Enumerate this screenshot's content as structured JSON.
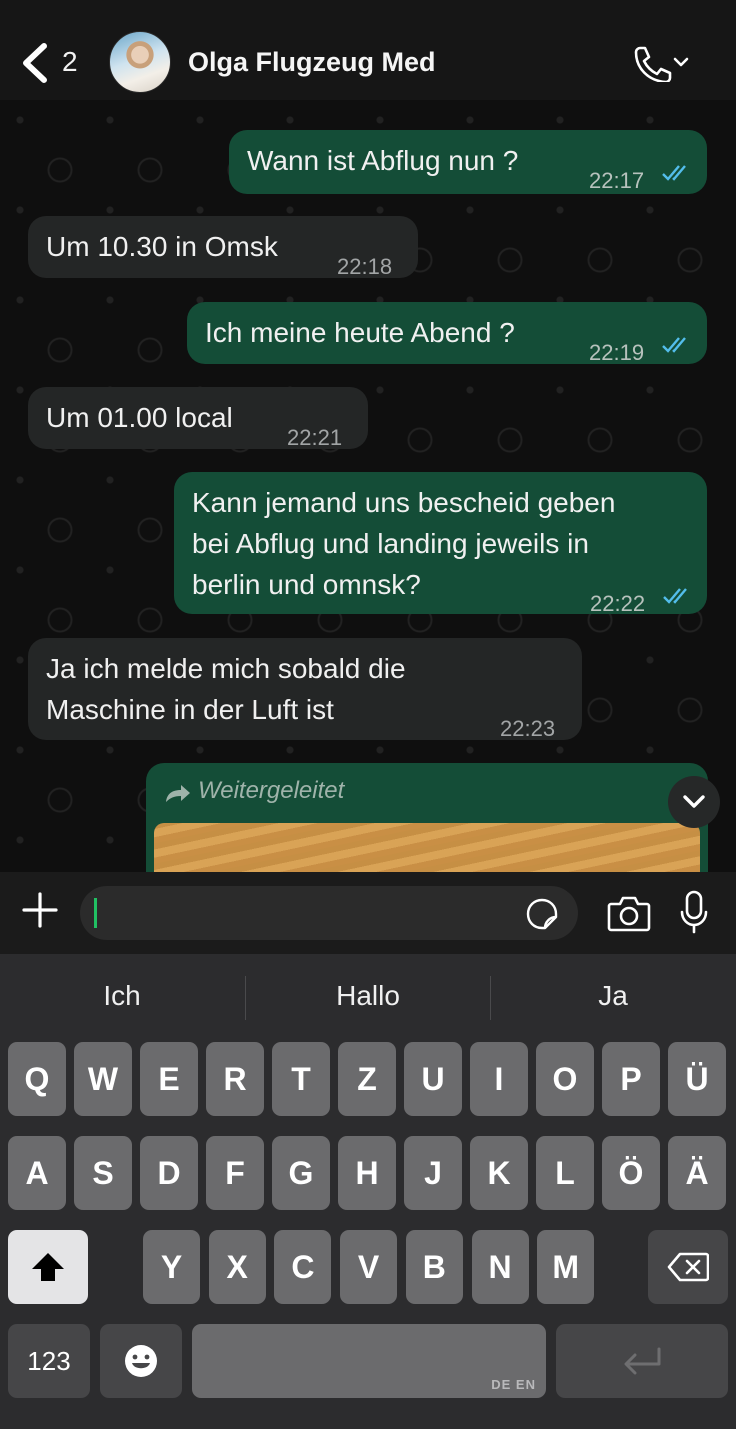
{
  "header": {
    "back_count": "2",
    "contact_name": "Olga Flugzeug Med"
  },
  "chat": {
    "messages": [
      {
        "direction": "out",
        "text": "Wann ist Abflug nun ?",
        "time": "22:17",
        "status": "read"
      },
      {
        "direction": "in",
        "text": "Um 10.30 in Omsk",
        "time": "22:18"
      },
      {
        "direction": "out",
        "text": "Ich meine heute Abend ?",
        "time": "22:19",
        "status": "read"
      },
      {
        "direction": "in",
        "text": "Um 01.00 local",
        "time": "22:21"
      },
      {
        "direction": "out",
        "lines": [
          "Kann jemand uns bescheid geben",
          "bei Abflug und landing jeweils in",
          "berlin und omnsk?"
        ],
        "time": "22:22",
        "status": "read"
      },
      {
        "direction": "in",
        "lines": [
          "Ja ich melde mich sobald die",
          "Maschine in der Luft ist"
        ],
        "time": "22:23"
      }
    ],
    "forwarded_label": "Weitergeleitet"
  },
  "input": {
    "placeholder": ""
  },
  "keyboard": {
    "suggestions": [
      "Ich",
      "Hallo",
      "Ja"
    ],
    "row1": [
      "Q",
      "W",
      "E",
      "R",
      "T",
      "Z",
      "U",
      "I",
      "O",
      "P",
      "Ü"
    ],
    "row2": [
      "A",
      "S",
      "D",
      "F",
      "G",
      "H",
      "J",
      "K",
      "L",
      "Ö",
      "Ä"
    ],
    "row3": [
      "Y",
      "X",
      "C",
      "V",
      "B",
      "N",
      "M"
    ],
    "numbers_key": "123",
    "space_languages": "DE EN"
  },
  "colors": {
    "outgoing_bubble": "#144d37",
    "incoming_bubble": "#242626",
    "read_ticks": "#53bdeb",
    "cursor": "#21c063"
  },
  "icons": [
    "back-chevron-icon",
    "call-icon",
    "forward-arrow-icon",
    "chevron-down-icon",
    "plus-icon",
    "sticker-icon",
    "camera-icon",
    "mic-icon",
    "shift-icon",
    "backspace-icon",
    "emoji-icon",
    "return-icon"
  ]
}
